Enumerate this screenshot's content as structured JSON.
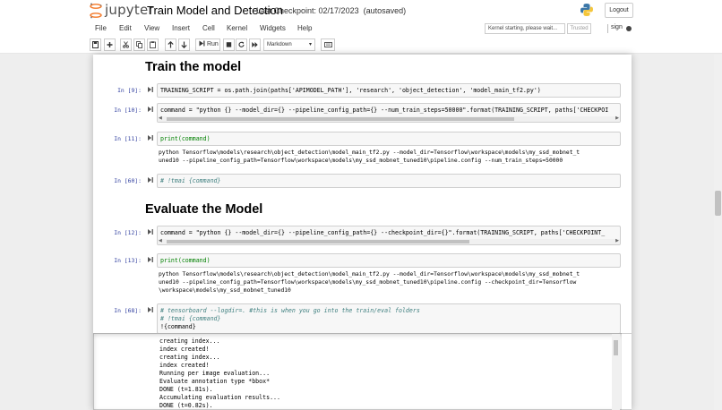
{
  "header": {
    "brand": "jupyter",
    "notebook_name": "Train Model and Detection",
    "checkpoint": "Last Checkpoint: 02/17/2023",
    "autosave": "(autosaved)",
    "logout_label": "Logout"
  },
  "menu": [
    "File",
    "Edit",
    "View",
    "Insert",
    "Cell",
    "Kernel",
    "Widgets",
    "Help"
  ],
  "kernel": {
    "status": "Kernel starting, please wait...",
    "trusted": "Trusted",
    "name": "sign"
  },
  "toolbar": {
    "run_label": "Run",
    "cell_type": "Markdown"
  },
  "cells": {
    "heading_train": "Train the model",
    "heading_eval": "Evaluate the Model",
    "c9": {
      "prompt": "In [9]:",
      "code": "TRAINING_SCRIPT = os.path.join(paths['APIMODEL_PATH'], 'research', 'object_detection', 'model_main_tf2.py')"
    },
    "c10": {
      "prompt": "In [10]:",
      "code": "command = \"python {} --model_dir={} --pipeline_config_path={} --num_train_steps=50000\".format(TRAINING_SCRIPT, paths['CHECKPOI"
    },
    "c11": {
      "prompt": "In [11]:",
      "code": "print(command)",
      "out1": "python Tensorflow\\models\\research\\object_detection\\model_main_tf2.py --model_dir=Tensorflow\\workspace\\models\\my_ssd_mobnet_t",
      "out2": "uned10 --pipeline_config_path=Tensorflow\\workspace\\models\\my_ssd_mobnet_tuned10\\pipeline.config --num_train_steps=50000"
    },
    "c60": {
      "prompt": "In [60]:",
      "code": "# !tmai {command}"
    },
    "c12": {
      "prompt": "In [12]:",
      "code": "command = \"python {} --model_dir={} --pipeline_config_path={} --checkpoint_dir={}\".format(TRAINING_SCRIPT, paths['CHECKPOINT_"
    },
    "c13": {
      "prompt": "In [13]:",
      "code": "print(command)",
      "out1": "python Tensorflow\\models\\research\\object_detection\\model_main_tf2.py --model_dir=Tensorflow\\workspace\\models\\my_ssd_mobnet_t",
      "out2": "uned10 --pipeline_config_path=Tensorflow\\workspace\\models\\my_ssd_mobnet_tuned10\\pipeline.config --checkpoint_dir=Tensorflow",
      "out3": "\\workspace\\models\\my_ssd_mobnet_tuned10"
    },
    "c68": {
      "prompt": "In [68]:",
      "line1": "# tensorboard --logdir=. #this is when you go into the train/eval folders",
      "line2": "# !tmai {command}",
      "line3": "!{command}"
    },
    "output_lines": [
      "creating index...",
      "index created!",
      "creating index...",
      "index created!",
      "Running per image evaluation...",
      "Evaluate annotation type *bbox*",
      "DONE (t=1.81s).",
      "Accumulating evaluation results...",
      "DONE (t=0.82s)."
    ]
  },
  "colors": {
    "prompt_in": "#303f9f",
    "string": "#ba2121",
    "keyword": "#008000",
    "comment": "#408080",
    "jupyter_orange": "#f37726"
  }
}
